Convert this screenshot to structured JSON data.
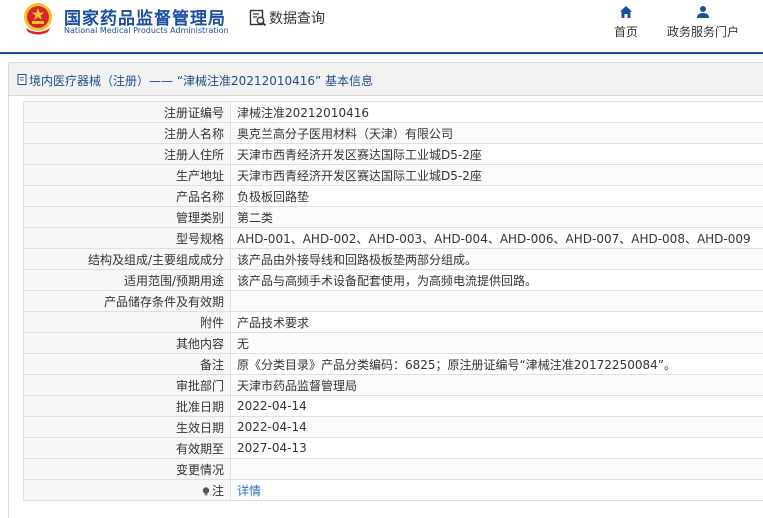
{
  "header": {
    "site_title_cn": "国家药品监督管理局",
    "site_title_en": "National Medical Products Administration",
    "query_label": "数据查询",
    "nav": [
      {
        "label": "首页",
        "icon": "home-icon"
      },
      {
        "label": "政务服务门户",
        "icon": "user-icon"
      }
    ]
  },
  "panel": {
    "title": "境内医疗器械（注册）—— “津械注准20212010416” 基本信息"
  },
  "rows": [
    {
      "label": "注册证编号",
      "value": "津械注准20212010416"
    },
    {
      "label": "注册人名称",
      "value": "奥克兰高分子医用材料（天津）有限公司"
    },
    {
      "label": "注册人住所",
      "value": "天津市西青经济开发区赛达国际工业城D5-2座"
    },
    {
      "label": "生产地址",
      "value": "天津市西青经济开发区赛达国际工业城D5-2座"
    },
    {
      "label": "产品名称",
      "value": "负极板回路垫"
    },
    {
      "label": "管理类别",
      "value": "第二类"
    },
    {
      "label": "型号规格",
      "value": "AHD-001、AHD-002、AHD-003、AHD-004、AHD-006、AHD-007、AHD-008、AHD-009"
    },
    {
      "label": "结构及组成/主要组成成分",
      "value": "该产品由外接导线和回路极板垫两部分组成。"
    },
    {
      "label": "适用范围/预期用途",
      "value": "该产品与高频手术设备配套使用，为高频电流提供回路。"
    },
    {
      "label": "产品储存条件及有效期",
      "value": ""
    },
    {
      "label": "附件",
      "value": "产品技术要求"
    },
    {
      "label": "其他内容",
      "value": "无"
    },
    {
      "label": "备注",
      "value": "原《分类目录》产品分类编码：6825；原注册证编号“津械注准20172250084”。"
    },
    {
      "label": "审批部门",
      "value": "天津市药品监督管理局"
    },
    {
      "label": "批准日期",
      "value": "2022-04-14"
    },
    {
      "label": "生效日期",
      "value": "2022-04-14"
    },
    {
      "label": "有效期至",
      "value": "2027-04-13"
    },
    {
      "label": "变更情况",
      "value": ""
    }
  ],
  "note_row": {
    "label": "注",
    "link": "详情",
    "icon": "lightbulb-icon"
  },
  "colors": {
    "brand": "#1b4fa0",
    "link": "#2b6cc4",
    "emblem_red": "#d7262b",
    "emblem_gold": "#f2c12e"
  }
}
